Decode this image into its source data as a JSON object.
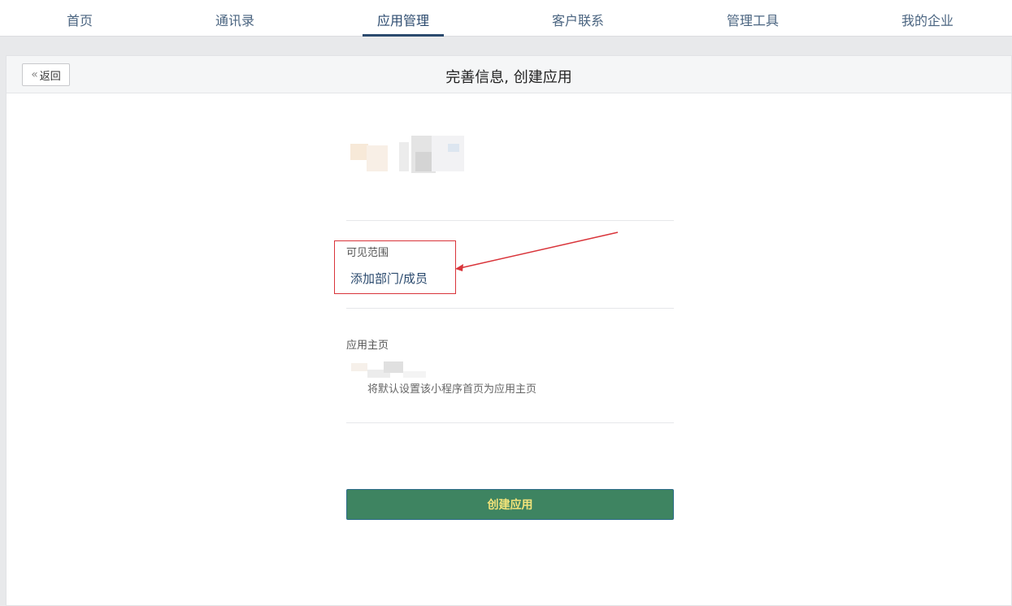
{
  "nav": {
    "items": [
      {
        "label": "首页",
        "active": false
      },
      {
        "label": "通讯录",
        "active": false
      },
      {
        "label": "应用管理",
        "active": true
      },
      {
        "label": "客户联系",
        "active": false
      },
      {
        "label": "管理工具",
        "active": false
      },
      {
        "label": "我的企业",
        "active": false
      }
    ]
  },
  "header": {
    "back_label": "返回",
    "title": "完善信息, 创建应用"
  },
  "form": {
    "visibility_label": "可见范围",
    "add_members_link": "添加部门/成员",
    "homepage_label": "应用主页",
    "homepage_hint": "将默认设置该小程序首页为应用主页",
    "create_button": "创建应用"
  },
  "colors": {
    "accent": "#2b4a6e",
    "create_button_bg": "#3e8461",
    "create_button_text": "#f2e37a",
    "annotation": "#d9343a"
  },
  "icons": {
    "back": "double-chevron-left-icon"
  }
}
